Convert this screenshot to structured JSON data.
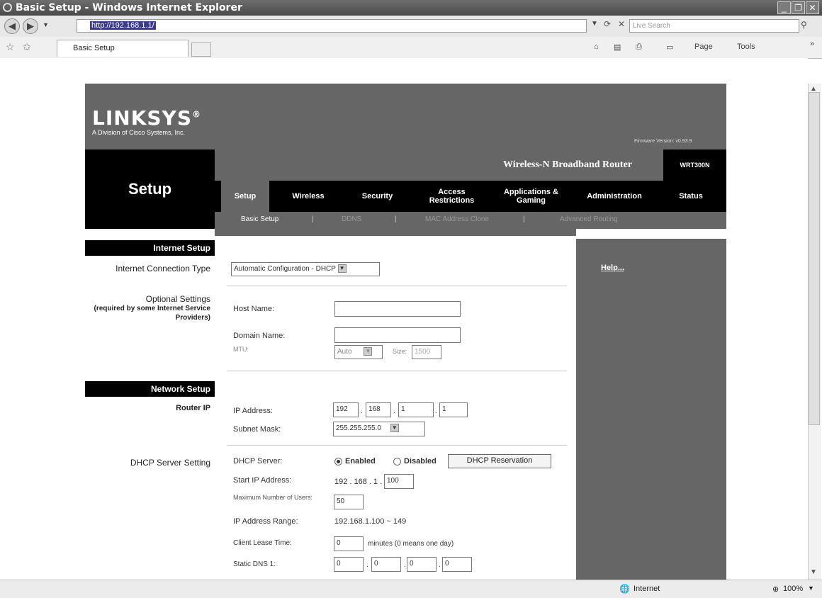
{
  "window": {
    "title": "Basic Setup - Windows Internet Explorer",
    "controls": [
      "_",
      "❐",
      "✕"
    ]
  },
  "browser": {
    "url": "http://192.168.1.1/",
    "search_placeholder": "Live Search",
    "tab_title": "Basic Setup",
    "toolbar": {
      "page": "Page",
      "tools": "Tools",
      "overflow": "»"
    },
    "status": {
      "zone": "Internet",
      "zoom": "100%"
    }
  },
  "router": {
    "logo": "LINKSYS",
    "logo_mark": "®",
    "logo_sub": "A Division of Cisco Systems, Inc.",
    "firmware": "Firmware Version: v0.93.9",
    "product_name": "Wireless-N Broadband Router",
    "model": "WRT300N",
    "page_title": "Setup",
    "tabs": [
      {
        "label": "Setup",
        "active": true
      },
      {
        "label": "Wireless"
      },
      {
        "label": "Security"
      },
      {
        "label": "Access Restrictions"
      },
      {
        "label": "Applications & Gaming"
      },
      {
        "label": "Administration"
      },
      {
        "label": "Status"
      }
    ],
    "subtabs": [
      "Basic Setup",
      "DDNS",
      "MAC Address Clone",
      "Advanced Routing"
    ],
    "subtab_sep": "|",
    "help": "Help..."
  },
  "sections": {
    "internet_setup": "Internet Setup",
    "connection_type_label": "Internet Connection Type",
    "optional_label": "Optional Settings",
    "optional_sub": "(required by some Internet Service Providers)",
    "network_setup": "Network Setup",
    "router_ip_label": "Router IP",
    "dhcp_label": "DHCP Server Setting"
  },
  "form": {
    "connection_type": "Automatic Configuration - DHCP",
    "host_name_label": "Host Name:",
    "host_name": "",
    "domain_name_label": "Domain Name:",
    "domain_name": "",
    "mtu_label": "MTU:",
    "mtu": "Auto",
    "size_label": "Size:",
    "size": "1500",
    "ip_label": "IP Address:",
    "ip": [
      "192",
      "168",
      "1",
      "1"
    ],
    "subnet_label": "Subnet Mask:",
    "subnet": "255.255.255.0",
    "dhcp_server_label": "DHCP Server:",
    "enabled": "Enabled",
    "disabled": "Disabled",
    "dhcp_reservation": "DHCP Reservation",
    "start_ip_label": "Start IP Address:",
    "start_ip_prefix": "192 . 168 . 1 .",
    "start_ip_last": "100",
    "max_users_label": "Maximum Number of Users:",
    "max_users": "50",
    "range_label": "IP Address Range:",
    "range": "192.168.1.100 ~ 149",
    "lease_label": "Client Lease Time:",
    "lease": "0",
    "lease_suffix": "minutes (0 means one day)",
    "dns1_label": "Static DNS 1:",
    "dns1": [
      "0",
      "0",
      "0",
      "0"
    ]
  }
}
